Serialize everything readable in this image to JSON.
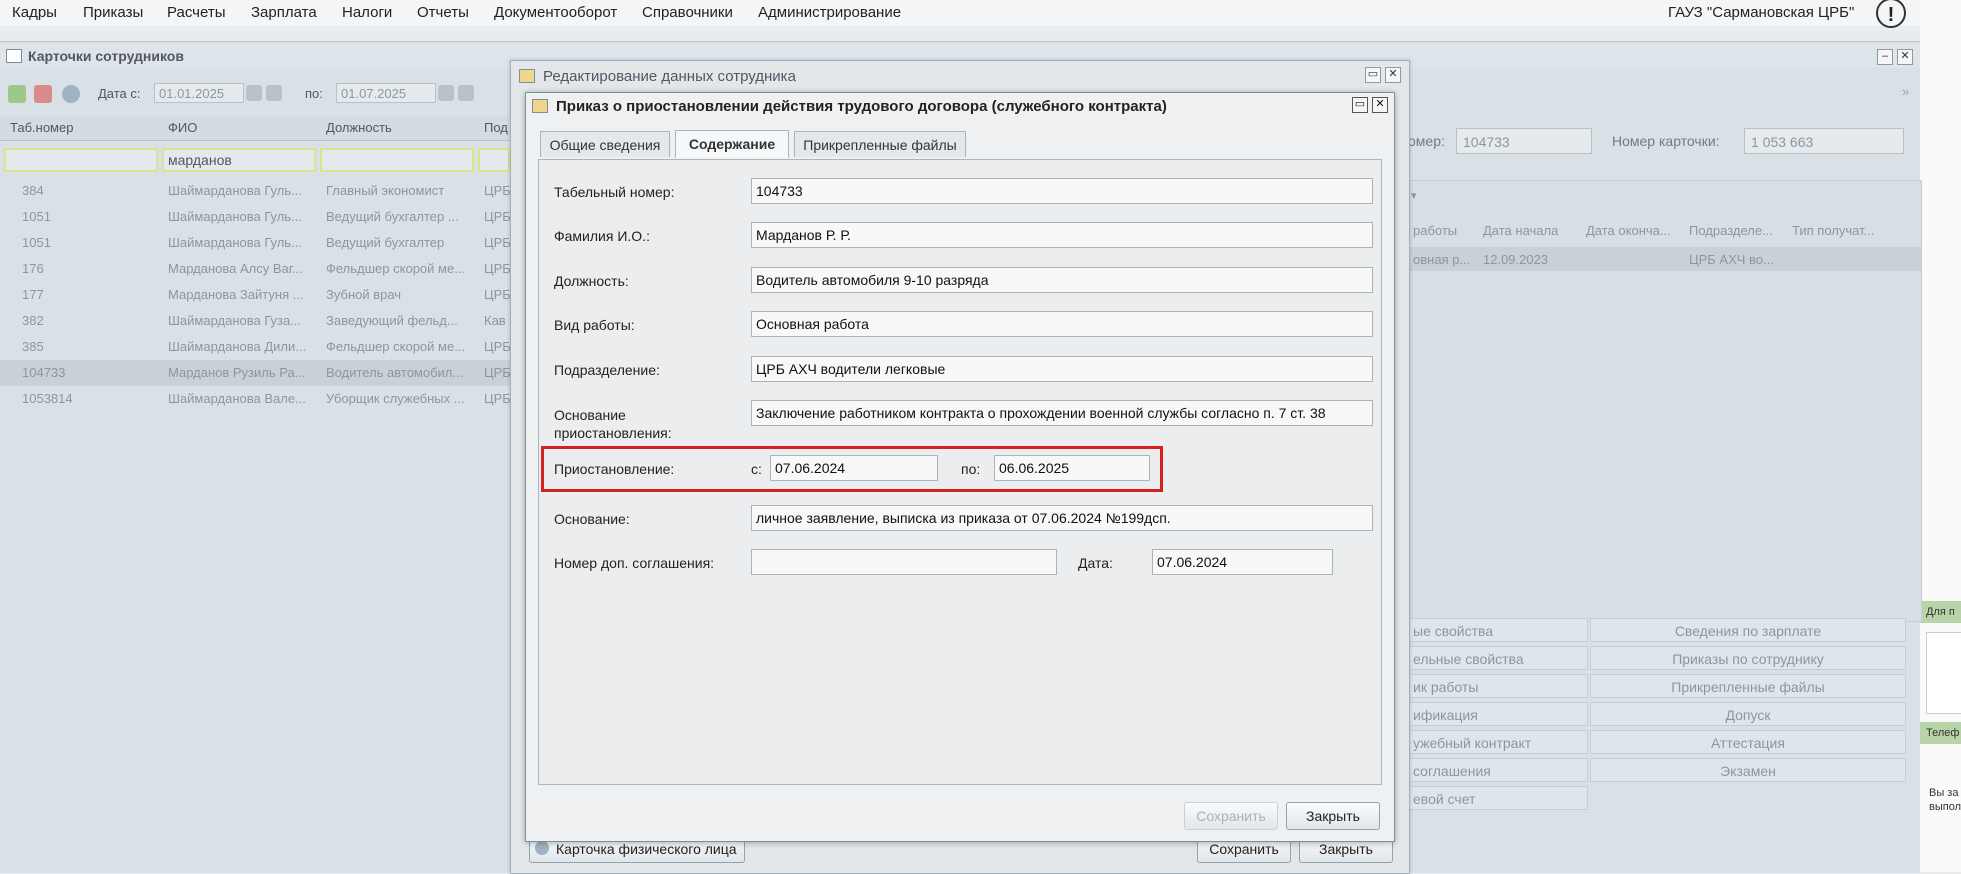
{
  "menu": [
    "Кадры",
    "Приказы",
    "Расчеты",
    "Зарплата",
    "Налоги",
    "Отчеты",
    "Документооборот",
    "Справочники",
    "Администрирование"
  ],
  "org_name": "ГАУЗ \"Сармановская ЦРБ\"",
  "alert_icon_glyph": "!",
  "bg_window": {
    "title": "Карточки сотрудников",
    "date_from_label": "Дата с:",
    "date_from": "01.01.2025",
    "date_to_label": "по:",
    "date_to": "01.07.2025",
    "columns": [
      "Таб.номер",
      "ФИО",
      "Должность",
      "Под"
    ],
    "filter_fio": "марданов",
    "rows": [
      [
        "384",
        "Шаймарданова Гуль...",
        "Главный экономист",
        "ЦРБ"
      ],
      [
        "1051",
        "Шаймарданова Гуль...",
        "Ведущий бухгалтер ...",
        "ЦРБ"
      ],
      [
        "1051",
        "Шаймарданова Гуль...",
        "Ведущий бухгалтер",
        "ЦРБ"
      ],
      [
        "176",
        "Марданова Алсу Ваг...",
        "Фельдшер скорой ме...",
        "ЦРБ"
      ],
      [
        "177",
        "Марданова Зайтуня ...",
        "Зубной врач",
        "ЦРБ"
      ],
      [
        "382",
        "Шаймарданова Гуза...",
        "Заведующий фельд...",
        "Кав"
      ],
      [
        "385",
        "Шаймарданова Дили...",
        "Фельдшер скорой ме...",
        "ЦРБ"
      ],
      [
        "104733",
        "Марданов Рузиль Ра...",
        "Водитель автомобил...",
        "ЦРБ"
      ],
      [
        "1053814",
        "Шаймарданова Вале...",
        "Уборщик служебных ...",
        "ЦРБ"
      ]
    ],
    "selected_row_index": 7,
    "right": {
      "tab_num_label": "омер:",
      "tab_num": "104733",
      "card_num_label": "Номер карточки:",
      "card_num": "1 053 663",
      "columns": [
        "работы",
        "Дата начала",
        "Дата оконча...",
        "Подразделе...",
        "Тип получат..."
      ],
      "row": [
        "овная р...",
        "12.09.2023",
        "",
        "ЦРБ АХЧ во...",
        ""
      ],
      "buttons_left": [
        "ые свойства",
        "ельные свойства",
        "ик работы",
        "ификация",
        "ужебный контракт",
        "соглашения",
        "евой счет"
      ],
      "buttons_right": [
        "Сведения по зарплате",
        "Приказы по сотруднику",
        "Прикрепленные файлы",
        "Допуск",
        "Аттестация",
        "Экзамен"
      ]
    },
    "strip_texts": [
      "Для п",
      "Телеф",
      "Вы за выпол"
    ]
  },
  "outer_dialog": {
    "title": "Редактирование данных сотрудника",
    "person_card_btn": "Карточка физического лица",
    "save_btn": "Сохранить",
    "close_btn": "Закрыть"
  },
  "dialog": {
    "title": "Приказ о приостановлении действия трудового договора (служебного контракта)",
    "tabs": [
      "Общие сведения",
      "Содержание",
      "Прикрепленные файлы"
    ],
    "active_tab": 1,
    "fields": {
      "tab_number_label": "Табельный номер:",
      "tab_number": "104733",
      "fio_label": "Фамилия И.О.:",
      "fio": "Марданов Р. Р.",
      "position_label": "Должность:",
      "position": "Водитель автомобиля 9-10 разряда",
      "work_type_label": "Вид работы:",
      "work_type": "Основная работа",
      "division_label": "Подразделение:",
      "division": "ЦРБ АХЧ водители легковые",
      "susp_basis_label": "Основание приостановления:",
      "susp_basis": "Заключение работником контракта о прохождении военной службы согласно п. 7 ст. 38",
      "suspension_label": "Приостановление:",
      "from_label": "с:",
      "from": "07.06.2024",
      "to_label": "по:",
      "to": "06.06.2025",
      "basis_label": "Основание:",
      "basis": "личное заявление, выписка из приказа от 07.06.2024 №199дсп.",
      "agreement_label": "Номер доп. соглашения:",
      "agreement": "",
      "date_label": "Дата:",
      "date": "07.06.2024"
    },
    "save_btn": "Сохранить",
    "close_btn": "Закрыть"
  }
}
